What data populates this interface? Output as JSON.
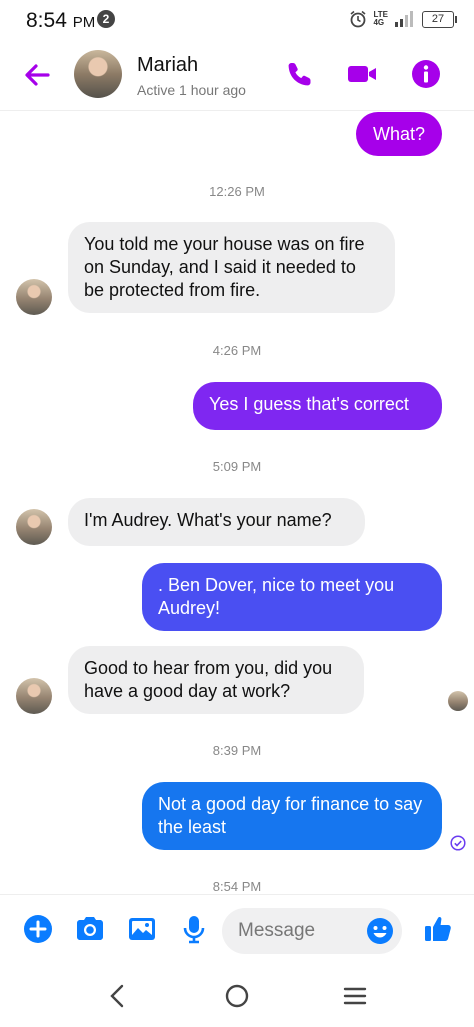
{
  "status_bar": {
    "time": "8:54",
    "ampm": "PM",
    "notification_count": "2",
    "network": "4G",
    "battery": "27"
  },
  "header": {
    "contact_name": "Mariah",
    "active_status": "Active 1 hour ago"
  },
  "messages": [
    {
      "type": "out",
      "text": "What?"
    },
    {
      "type": "timestamp",
      "text": "12:26 PM"
    },
    {
      "type": "in",
      "text": "You told me your house was on fire on Sunday, and I said it needed to be protected from fire."
    },
    {
      "type": "timestamp",
      "text": "4:26 PM"
    },
    {
      "type": "out",
      "text": "Yes I guess that's correct"
    },
    {
      "type": "timestamp",
      "text": "5:09 PM"
    },
    {
      "type": "in",
      "text": "I'm Audrey. What's your name?"
    },
    {
      "type": "out",
      "text": ". Ben Dover, nice to meet you Audrey!"
    },
    {
      "type": "in",
      "text": "Good to hear from you, did you have a good day at work?"
    },
    {
      "type": "timestamp",
      "text": "8:39 PM"
    },
    {
      "type": "out",
      "text": "Not a good day for finance to say the least"
    },
    {
      "type": "timestamp",
      "text": "8:54 PM"
    }
  ],
  "composer": {
    "placeholder": "Message"
  },
  "colors": {
    "accent": "#a600ea",
    "bubble_purple": "#9b0cf3",
    "bubble_indigo": "#6b3cf0",
    "bubble_blue": "#4056f2",
    "bubble_azure": "#1676ef",
    "composer_blue": "#0a7cff"
  }
}
